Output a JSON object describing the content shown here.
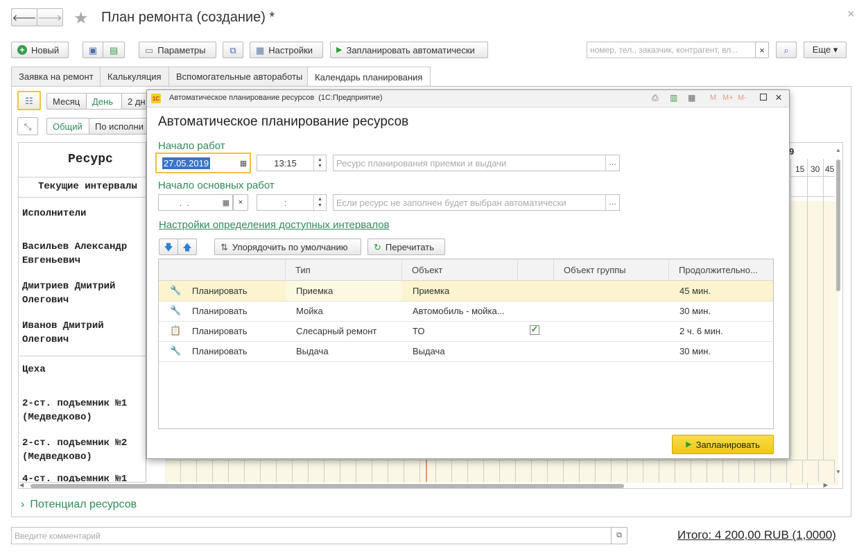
{
  "header": {
    "title": "План ремонта (создание) *",
    "close": "×"
  },
  "toolbar": {
    "new_label": "Новый",
    "params_label": "Параметры",
    "settings_label": "Настройки",
    "schedule_auto_label": "Запланировать автоматически",
    "search_placeholder": "номер, тел., заказчик, контрагент, вл...",
    "search_clear": "×",
    "more_label": "Еще ▾"
  },
  "tabs": [
    {
      "label": "Заявка на ремонт"
    },
    {
      "label": "Калькуляция"
    },
    {
      "label": "Вспомогательные автоработы"
    },
    {
      "label": "Календарь планирования"
    }
  ],
  "calendar": {
    "period_month": "Месяц",
    "period_day": "День",
    "period_2": "2 дн",
    "view_general": "Общий",
    "view_by_executor": "По исполни",
    "resource_header": "Ресурс",
    "current_intervals": "Текущие интервалы",
    "date_fragment": "9",
    "time_cols": [
      "15",
      "30",
      "45"
    ],
    "rows": [
      {
        "label": "Исполнители"
      },
      {
        "label": "Васильев Александр Евгеньевич"
      },
      {
        "label": "Дмитриев Дмитрий Олегович"
      },
      {
        "label": "Иванов Дмитрий Олегович"
      },
      {
        "label": "Цеха"
      },
      {
        "label": "2-ст. подъемник №1 (Медведково)"
      },
      {
        "label": "2-ст. подъемник №2 (Медведково)"
      },
      {
        "label": "4-ст. подъемник №1"
      }
    ]
  },
  "potential": {
    "label": "Потенциал ресурсов"
  },
  "footer": {
    "comment_placeholder": "Введите комментарий",
    "total": "Итого: 4 200,00 RUB (1,0000)"
  },
  "dialog": {
    "window_title": "Автоматическое планирование ресурсов  (1С:Предприятие)",
    "title_icons": [
      "M",
      "M+",
      "M-"
    ],
    "heading": "Автоматическое планирование ресурсов",
    "start_label": "Начало работ",
    "start_date": "27.05.2019",
    "start_time": "13:15",
    "resource_placeholder": "Ресурс планирования приемки и выдачи",
    "main_start_label": "Начало основных работ",
    "main_date": " .  .",
    "main_time": ":",
    "main_resource_placeholder": "Если ресурс не заполнен будет выбран автоматически",
    "intervals_link": "Настройки определения доступных интервалов",
    "sort_default_label": "Упорядочить по умолчанию",
    "recalc_label": "Перечитать",
    "columns": [
      "Тип",
      "Объект",
      "Объект группы",
      "Продолжительно..."
    ],
    "rows": [
      {
        "action": "Планировать",
        "type": "Приемка",
        "object": "Приемка",
        "group_checked": false,
        "duration": "45 мин."
      },
      {
        "action": "Планировать",
        "type": "Мойка",
        "object": "Автомобиль - мойка...",
        "group_checked": false,
        "duration": "30 мин."
      },
      {
        "action": "Планировать",
        "type": "Слесарный ремонт",
        "object": "ТО",
        "group_checked": true,
        "duration": "2 ч. 6 мин."
      },
      {
        "action": "Планировать",
        "type": "Выдача",
        "object": "Выдача",
        "group_checked": false,
        "duration": "30 мин."
      }
    ],
    "schedule_label": "Запланировать"
  },
  "colors": {
    "accent_green": "#2e8b57",
    "selected_row": "#fbf4cf",
    "primary_button": "#f4d11a"
  }
}
